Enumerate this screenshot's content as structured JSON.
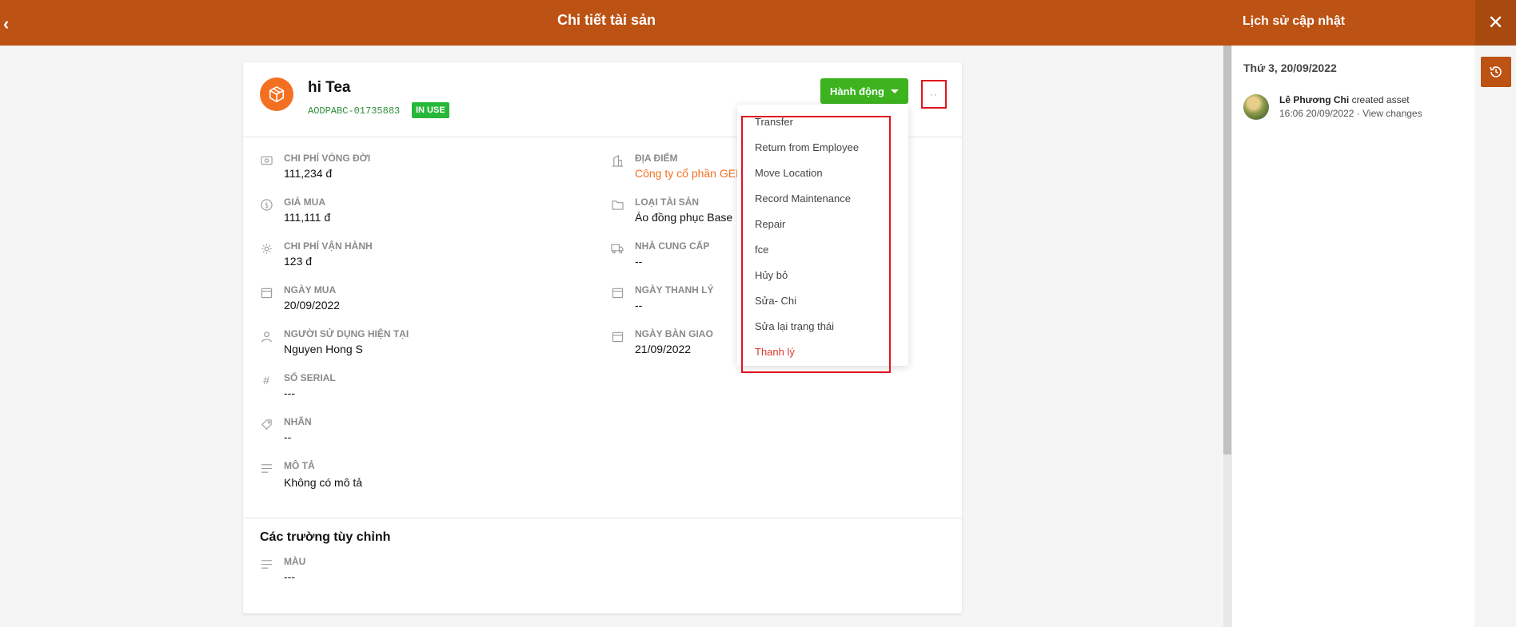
{
  "header": {
    "back_glyph": "‹",
    "title": "Chi tiết tài sản"
  },
  "asset": {
    "name": "hi Tea",
    "code": "AODPABC-01735883",
    "status": "IN USE",
    "action_label": "Hành động",
    "more_glyph": "··"
  },
  "fields_left": [
    {
      "icon": "money-icon",
      "label": "CHI PHÍ VÒNG ĐỜI",
      "value": "111,234 đ"
    },
    {
      "icon": "dollar-icon",
      "label": "GIÁ MUA",
      "value": "111,111 đ"
    },
    {
      "icon": "gear-icon",
      "label": "CHI PHÍ VẬN HÀNH",
      "value": "123 đ"
    },
    {
      "icon": "calendar-icon",
      "label": "NGÀY MUA",
      "value": "20/09/2022"
    },
    {
      "icon": "user-icon",
      "label": "NGƯỜI SỬ DỤNG HIỆN TẠI",
      "value": "Nguyen Hong S"
    },
    {
      "icon": "hash-icon",
      "label": "SỐ SERIAL",
      "value": "---"
    },
    {
      "icon": "tag-icon",
      "label": "NHÃN",
      "value": "--"
    },
    {
      "icon": "lines-icon",
      "label": "MÔ TẢ",
      "value": "Không có mô tả"
    }
  ],
  "fields_right": [
    {
      "icon": "building-icon",
      "label": "ĐỊA ĐIỂM",
      "value": "Công ty cổ phần GEM"
    },
    {
      "icon": "folder-icon",
      "label": "LOẠI TÀI SẢN",
      "value": "Áo đồng phục Base"
    },
    {
      "icon": "truck-icon",
      "label": "NHÀ CUNG CẤP",
      "value": "--"
    },
    {
      "icon": "calendar-icon",
      "label": "NGÀY THANH LÝ",
      "value": "--"
    },
    {
      "icon": "calendar-icon",
      "label": "NGÀY BÀN GIAO",
      "value": "21/09/2022"
    }
  ],
  "custom": {
    "title": "Các trường tùy chỉnh",
    "field": {
      "icon": "lines-icon",
      "label": "MÀU",
      "value": "---"
    }
  },
  "dropdown": [
    "Transfer",
    "Return from Employee",
    "Move Location",
    "Record Maintenance",
    "Repair",
    "fce",
    "Hủy bỏ",
    "Sửa- Chi",
    "Sửa lại trạng thái",
    "Thanh lý"
  ],
  "history": {
    "title": "Lịch sử cập nhật",
    "close_glyph": "✕",
    "date": "Thứ 3, 20/09/2022",
    "user": "Lê Phương Chi",
    "action": "created asset",
    "time": "16:06 20/09/2022",
    "separator": "·",
    "view_changes": "View changes"
  },
  "colors": {
    "brand": "#bc5213",
    "accent": "#f37021",
    "success": "#3cb31f",
    "danger": "#d93a2b"
  }
}
